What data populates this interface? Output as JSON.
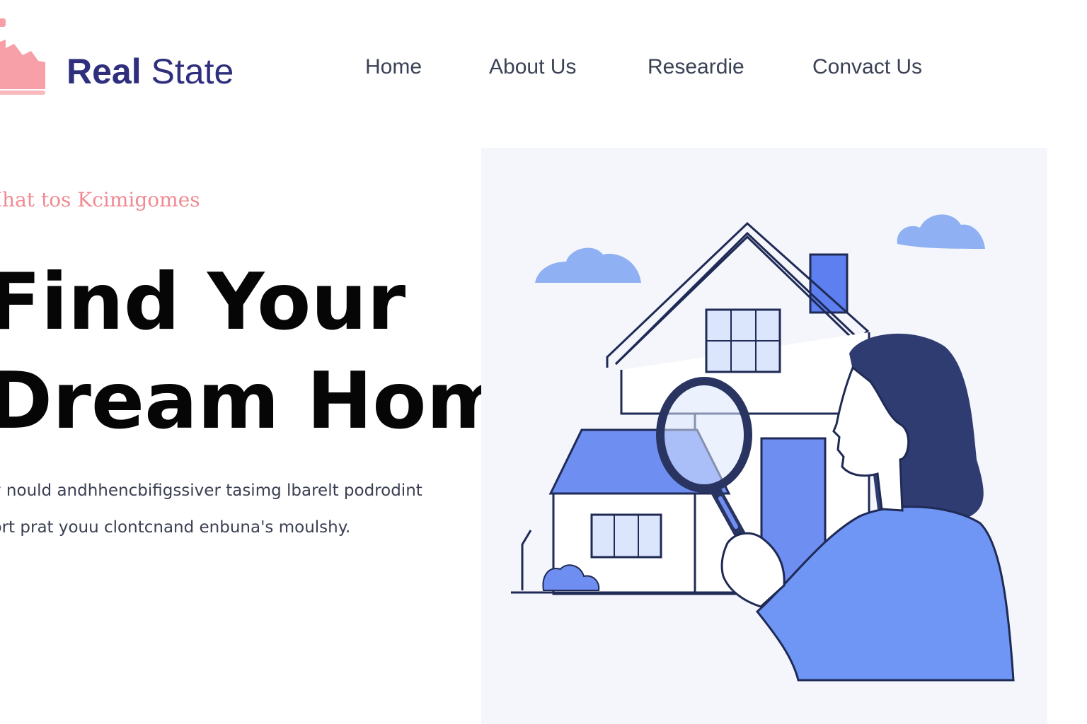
{
  "brand": {
    "bold": "Real",
    "rest": "State"
  },
  "nav": {
    "items": [
      "Home",
      "About Us",
      "Researdie",
      "Convact Us"
    ]
  },
  "hero": {
    "eyebrow": "Ihat tos Kcimigomes",
    "headline_line1": "Find Your",
    "headline_line2": "Dream Home",
    "desc_line1": "y nould andhhencbifigssiver tasimg lbarelt podrodint",
    "desc_line2": "prt prat youu clontcnand enbuna's moulshy."
  },
  "colors": {
    "brand_text": "#2f2f7e",
    "logo": "#f7a0a8",
    "eyebrow": "#f08a92",
    "illustration_blue": "#6f96f5",
    "illustration_outline": "#1f2a55",
    "panel_bg": "#f4f6fc"
  },
  "icons": {
    "logo": "house-logo-icon"
  }
}
